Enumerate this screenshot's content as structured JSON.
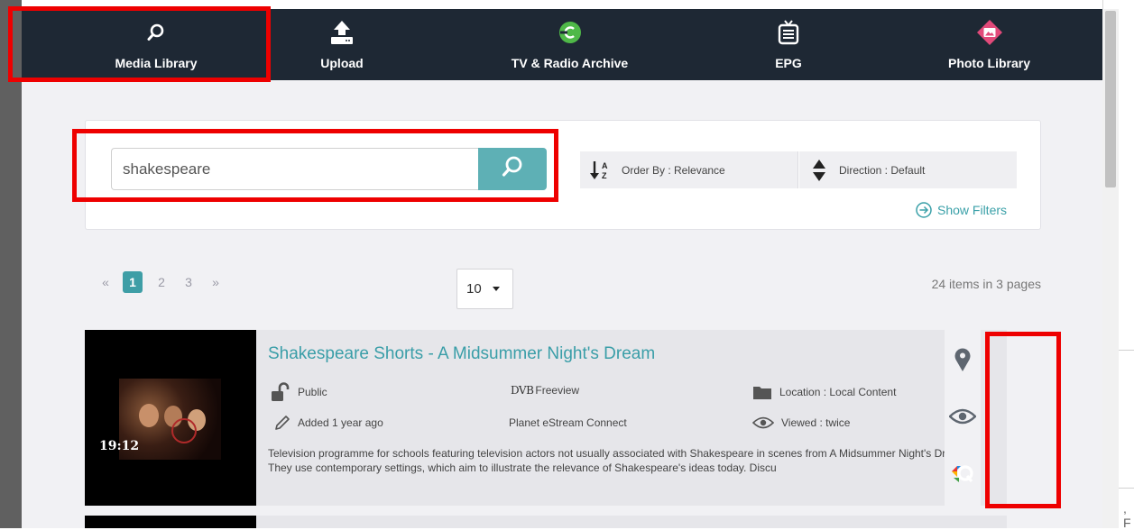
{
  "nav": {
    "media_library": "Media Library",
    "upload": "Upload",
    "tv_radio": "TV & Radio Archive",
    "epg": "EPG",
    "photo_library": "Photo Library"
  },
  "search": {
    "value": "shakespeare",
    "order_label": "Order By : Relevance",
    "direction_label": "Direction : Default",
    "show_filters": "Show Filters"
  },
  "pagination": {
    "prev": "«",
    "pages": [
      "1",
      "2",
      "3"
    ],
    "next": "»",
    "per_page": "10",
    "summary": "24 items in 3 pages"
  },
  "result": {
    "title": "Shakespeare Shorts - A Midsummer Night's Dream",
    "duration": "19:12",
    "visibility": "Public",
    "channel": "Freeview",
    "channel_logo": "DVB",
    "location": "Location : Local Content",
    "added": "Added 1 year ago",
    "source": "Planet eStream Connect",
    "views": "Viewed : twice",
    "description": "Television programme for schools featuring television actors not usually associated with Shakespeare in scenes from A Midsummer Night's Dream. They use contemporary settings, which aim to illustrate the relevance of Shakespeare's ideas today. Discu"
  },
  "edge_text": ", F",
  "colors": {
    "nav_bg": "#1e2834",
    "accent": "#3aa0a8",
    "highlight": "#ee0000"
  }
}
